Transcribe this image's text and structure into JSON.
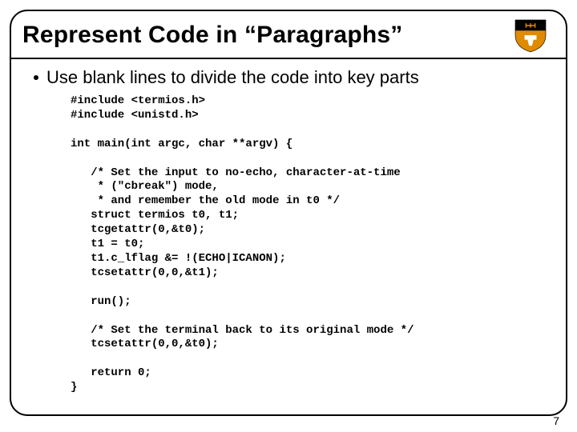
{
  "slide": {
    "title": "Represent Code in “Paragraphs”",
    "bullet": "Use blank lines to divide the code into key parts",
    "code": "#include <termios.h>\n#include <unistd.h>\n\nint main(int argc, char **argv) {\n\n   /* Set the input to no-echo, character-at-time\n    * (\"cbreak\") mode,\n    * and remember the old mode in t0 */\n   struct termios t0, t1;\n   tcgetattr(0,&t0);\n   t1 = t0;\n   t1.c_lflag &= !(ECHO|ICANON);\n   tcsetattr(0,0,&t1);\n\n   run();\n\n   /* Set the terminal back to its original mode */\n   tcsetattr(0,0,&t0);\n\n   return 0;\n}",
    "page_number": "7",
    "logo_name": "princeton-shield"
  }
}
